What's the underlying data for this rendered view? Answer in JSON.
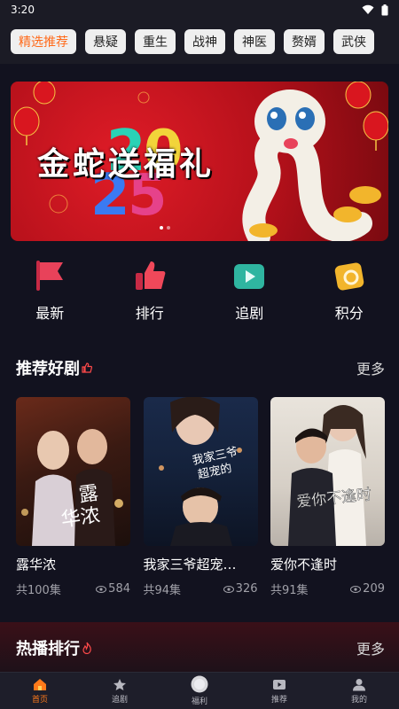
{
  "status": {
    "time": "3:20"
  },
  "tabs": [
    "精选推荐",
    "悬疑",
    "重生",
    "战神",
    "神医",
    "赘婿",
    "武侠"
  ],
  "banner": {
    "title": "金蛇送福礼",
    "year": "2025"
  },
  "quick": [
    {
      "label": "最新",
      "icon": "flag-icon",
      "color": "#e8425a"
    },
    {
      "label": "排行",
      "icon": "thumbs-up-icon",
      "color": "#f0485a"
    },
    {
      "label": "追剧",
      "icon": "video-icon",
      "color": "#2fb5a0"
    },
    {
      "label": "积分",
      "icon": "coin-icon",
      "color": "#f2b52c"
    }
  ],
  "recommend": {
    "title": "推荐好剧",
    "more": "更多",
    "items": [
      {
        "title": "露华浓",
        "episodes": "共100集",
        "views": "584",
        "poster_text": "露华浓"
      },
      {
        "title": "我家三爷超宠…",
        "episodes": "共94集",
        "views": "326",
        "poster_text": "我家三爷超宠的"
      },
      {
        "title": "爱你不逢时",
        "episodes": "共91集",
        "views": "209",
        "poster_text": "爱你不逢时"
      }
    ]
  },
  "hot": {
    "title": "热播排行",
    "more": "更多"
  },
  "nav": [
    "首页",
    "追剧",
    "福利",
    "推荐",
    "我的"
  ],
  "colors": {
    "accent": "#ff6a1a",
    "background": "#12121f"
  }
}
